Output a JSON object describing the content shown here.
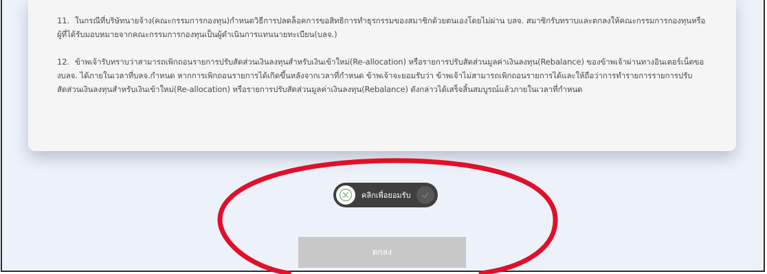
{
  "terms": [
    {
      "number": "11.",
      "text": "ในกรณีที่บริษัทนายจ้าง(คณะกรรมการกองทุน)กำหนดวิธีการปลดล็อคการขอสิทธิการทำธุรกรรมของสมาชิกด้วยตนเองโดยไม่ผ่าน  บลจ.  สมาชิกรับทราบและตกลงให้คณะกรรมการกองทุนหรือผู้ที่ได้รับมอบหมายจากคณะกรรมการกองทุนเป็นผู้ดำเนินการแทนนายทะเบียน(บลจ.)"
    },
    {
      "number": "12.",
      "text": "ข้าพเจ้ารับทราบว่าสามารถเพิกถอนรายการปรับสัดส่วนเงินลงทุนสำหรับเงินเข้าใหม่(Re-allocation)  หรือรายการปรับสัดส่วนมูลค่าเงินลงทุน(Rebalance)  ของข้าพเจ้าผ่านทางอินเตอร์เน็ตของบลจ. ได้ภายในเวลาที่บลจ.กำหนด  หากการเพิกถอนรายการได้เกิดขึ้นหลังจากเวลาที่กำหนด  ข้าพเจ้าจะยอมรับว่า  ข้าพเจ้าไม่สามารถเพิกถอนรายการได้และให้ถือว่าการทำรายการรายการปรับสัดส่วนเงินลงทุนสำหรับเงินเข้าใหม่(Re-allocation)  หรือรายการปรับสัดส่วนมูลค่าเงินลงทุน(Rebalance)  ดังกล่าวได้เสร็จสิ้นสมบูรณ์แล้วภายในเวลาที่กำหนด"
    }
  ],
  "consent": {
    "label": "คลิกเพื่อยอมรับ",
    "state": "unchecked",
    "left_icon": "x-circle-icon",
    "right_icon": "check-circle-icon"
  },
  "actions": {
    "ok_label": "ตกลง",
    "ok_state": "disabled"
  },
  "colors": {
    "page_background": "#edf2fa",
    "card_background": "#f5f5f5",
    "body_text": "#4a4a4a",
    "toggle_background": "#3f3f3f",
    "ok_button_disabled": "#c8c8c8",
    "highlight_annotation": "#e0102a"
  }
}
